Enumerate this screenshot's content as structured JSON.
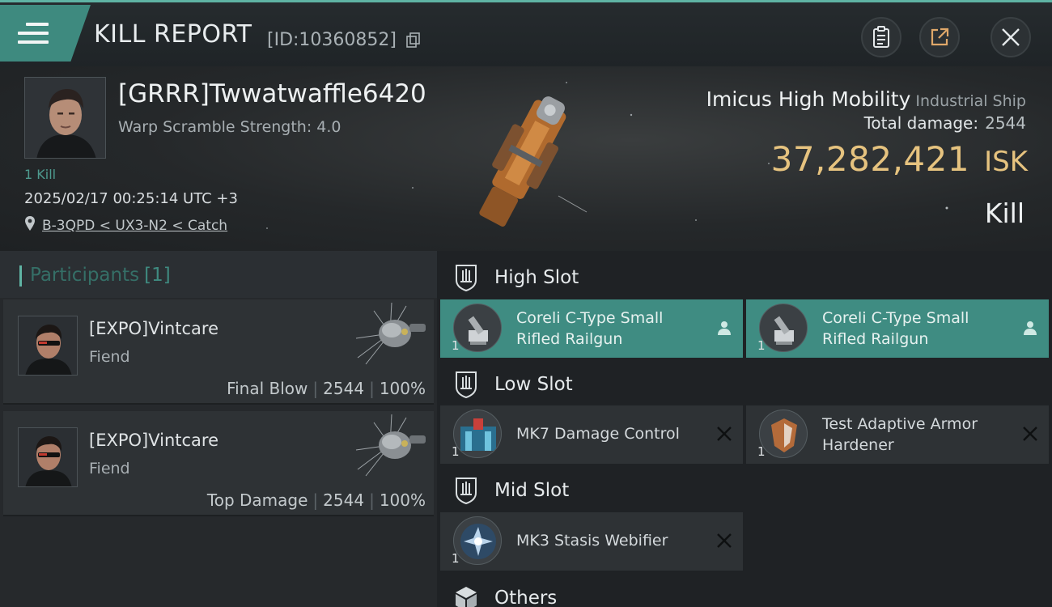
{
  "header": {
    "title": "KILL REPORT",
    "report_id": "[ID:10360852]"
  },
  "victim": {
    "name": "[GRRR]Twwatwaffle6420",
    "warp_scramble": "Warp Scramble Strength: 4.0",
    "kill_count": "1 Kill",
    "timestamp": "2025/02/17 00:25:14 UTC +3",
    "location": "B-3QPD < UX3-N2 < Catch"
  },
  "ship": {
    "name": "Imicus High Mobility",
    "class": "Industrial Ship",
    "total_damage_label": "Total damage:",
    "total_damage": "2544",
    "isk_value": "37,282,421",
    "isk_unit": "ISK",
    "result": "Kill"
  },
  "participants": {
    "title": "Participants",
    "count": "[1]",
    "rows": [
      {
        "name": "[EXPO]Vintcare",
        "ship": "Fiend",
        "role": "Final Blow",
        "damage": "2544",
        "percent": "100%"
      },
      {
        "name": "[EXPO]Vintcare",
        "ship": "Fiend",
        "role": "Top Damage",
        "damage": "2544",
        "percent": "100%"
      }
    ]
  },
  "fitting": {
    "high_slot": {
      "label": "High Slot",
      "modules": [
        {
          "name": "Coreli C-Type Small Rifled Railgun",
          "qty": "1"
        },
        {
          "name": "Coreli C-Type Small Rifled Railgun",
          "qty": "1"
        }
      ]
    },
    "low_slot": {
      "label": "Low Slot",
      "modules": [
        {
          "name": "MK7 Damage Control",
          "qty": "1"
        },
        {
          "name": "Test Adaptive Armor Hardener",
          "qty": "1"
        }
      ]
    },
    "mid_slot": {
      "label": "Mid Slot",
      "modules": [
        {
          "name": "MK3 Stasis Webifier",
          "qty": "1"
        }
      ]
    },
    "others": {
      "label": "Others"
    }
  },
  "colors": {
    "accent": "#5fb3a4",
    "isk_gold": "#e6c37f",
    "active_module": "#3f8c82"
  },
  "icons": [
    "menu-icon",
    "copy-icon",
    "clipboard-icon",
    "share-icon",
    "close-icon",
    "location-pin-icon",
    "pilot-icon",
    "dropped-x-icon",
    "slot-shield-icon",
    "box-icon"
  ]
}
